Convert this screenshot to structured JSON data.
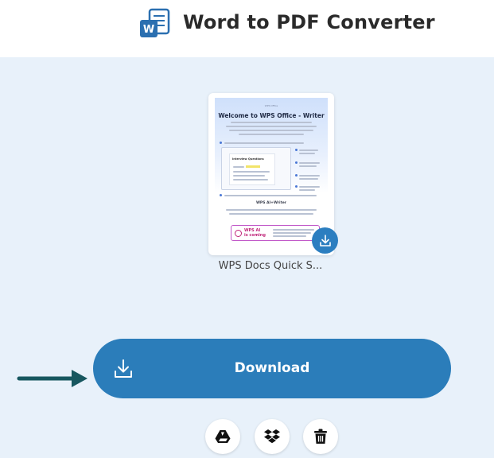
{
  "header": {
    "title": "Word to PDF Converter",
    "logo_icon": "word-document-icon",
    "logo_letter": "W"
  },
  "file_card": {
    "file_name": "WPS Docs Quick S...",
    "thumbnail": {
      "brand": "WPS Office",
      "title": "Welcome to WPS Office - Writer",
      "doc_heading": "Interview Questions",
      "section_heading": "WPS AI+Writer",
      "ai_badge": [
        "WPS AI",
        "is coming"
      ]
    },
    "download_icon": "download-icon"
  },
  "actions": {
    "download_label": "Download",
    "download_icon": "download-icon",
    "pointer_icon": "arrow-right-icon",
    "secondary": [
      {
        "name": "google-drive-button",
        "icon": "google-drive-icon"
      },
      {
        "name": "dropbox-button",
        "icon": "dropbox-icon"
      },
      {
        "name": "delete-button",
        "icon": "trash-icon"
      }
    ]
  },
  "colors": {
    "accent": "#2b7dba",
    "background": "#e8f1fa",
    "arrow": "#17575f"
  }
}
